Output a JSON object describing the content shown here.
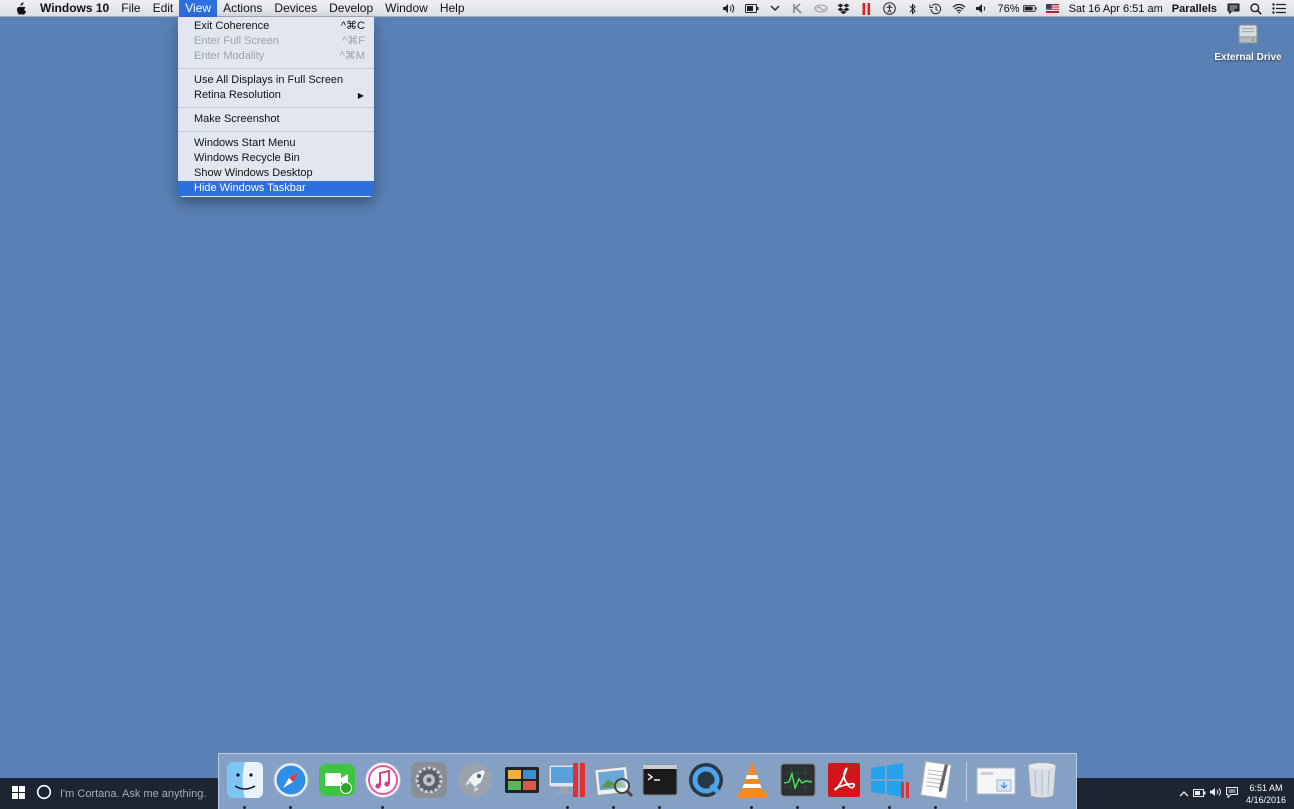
{
  "menubar": {
    "app_name": "Windows 10",
    "menus": [
      "File",
      "Edit",
      "View",
      "Actions",
      "Devices",
      "Develop",
      "Window",
      "Help"
    ],
    "active_menu": "View",
    "battery": "76%",
    "datetime": "Sat 16 Apr  6:51 am",
    "user": "Parallels"
  },
  "view_menu": {
    "groups": [
      [
        {
          "label": "Exit Coherence",
          "shortcut": "^⌘C",
          "enabled": true
        },
        {
          "label": "Enter Full Screen",
          "shortcut": "^⌘F",
          "enabled": false
        },
        {
          "label": "Enter Modality",
          "shortcut": "^⌘M",
          "enabled": false
        }
      ],
      [
        {
          "label": "Use All Displays in Full Screen",
          "shortcut": "",
          "enabled": true
        },
        {
          "label": "Retina Resolution",
          "shortcut": "",
          "enabled": true,
          "submenu": true
        }
      ],
      [
        {
          "label": "Make Screenshot",
          "shortcut": "",
          "enabled": true
        }
      ],
      [
        {
          "label": "Windows Start Menu",
          "shortcut": "",
          "enabled": true
        },
        {
          "label": "Windows Recycle Bin",
          "shortcut": "",
          "enabled": true
        },
        {
          "label": "Show Windows Desktop",
          "shortcut": "",
          "enabled": true
        },
        {
          "label": "Hide Windows Taskbar",
          "shortcut": "",
          "enabled": true,
          "highlighted": true
        }
      ]
    ]
  },
  "desktop": {
    "icons": [
      {
        "label": "External Drive",
        "icon": "external-drive-icon"
      }
    ]
  },
  "dock": {
    "apps": [
      {
        "name": "finder",
        "icon": "finder-icon",
        "running": true
      },
      {
        "name": "safari",
        "icon": "safari-icon",
        "running": true
      },
      {
        "name": "facetime",
        "icon": "facetime-icon",
        "running": false
      },
      {
        "name": "itunes",
        "icon": "itunes-icon",
        "running": true
      },
      {
        "name": "system-preferences",
        "icon": "gear-icon",
        "running": false
      },
      {
        "name": "launchpad",
        "icon": "rocket-icon",
        "running": false
      },
      {
        "name": "photo-browser",
        "icon": "photo-browser-icon",
        "running": false
      },
      {
        "name": "parallels-desktop",
        "icon": "parallels-icon",
        "running": true
      },
      {
        "name": "preview",
        "icon": "preview-icon",
        "running": true
      },
      {
        "name": "terminal",
        "icon": "terminal-icon",
        "running": true
      },
      {
        "name": "quicktime",
        "icon": "quicktime-icon",
        "running": false
      },
      {
        "name": "vlc",
        "icon": "vlc-icon",
        "running": true
      },
      {
        "name": "activity-monitor",
        "icon": "activity-monitor-icon",
        "running": true
      },
      {
        "name": "acrobat",
        "icon": "acrobat-icon",
        "running": true
      },
      {
        "name": "windows-10",
        "icon": "windows-parallels-icon",
        "running": true
      },
      {
        "name": "textedit",
        "icon": "textedit-icon",
        "running": true
      }
    ],
    "trailing": [
      {
        "name": "downloads",
        "icon": "downloads-icon"
      },
      {
        "name": "trash",
        "icon": "trash-icon"
      }
    ]
  },
  "taskbar": {
    "cortana_placeholder": "I'm Cortana. Ask me anything.",
    "time": "6:51 AM",
    "date": "4/16/2016"
  },
  "colors": {
    "desktop": "#5a80b6",
    "menu_highlight": "#2d6fdd",
    "taskbar": "#1d2432"
  }
}
